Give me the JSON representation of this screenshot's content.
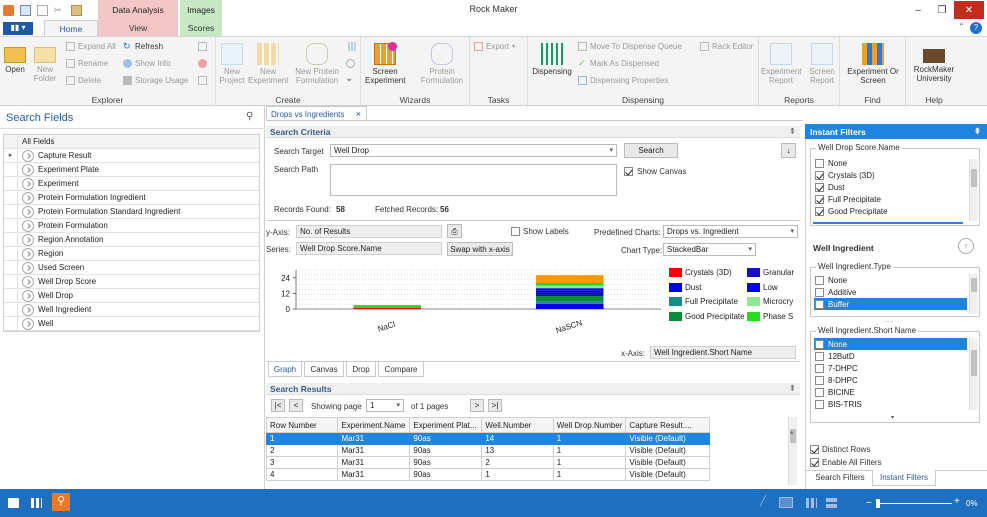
{
  "app": {
    "title": "Rock Maker"
  },
  "context_tabs": {
    "data_analysis": "Data Analysis",
    "images": "Images"
  },
  "tabs": {
    "file": "",
    "home": "Home",
    "view": "View",
    "scores": "Scores"
  },
  "ribbon": {
    "explorer": {
      "label": "Explorer",
      "open": "Open",
      "new_folder": "New\nFolder",
      "expand_all": "Expand All",
      "refresh": "Refresh",
      "rename": "Rename",
      "show_info": "Show Info",
      "delete": "Delete",
      "storage_usage": "Storage Usage"
    },
    "create": {
      "label": "Create",
      "new_project": "New\nProject",
      "new_experiment": "New\nExperiment",
      "new_protein_formulation": "New Protein\nFormulation"
    },
    "wizards": {
      "label": "Wizards",
      "screen_experiment": "Screen\nExperiment",
      "protein_formulation": "Protein\nFormulation"
    },
    "tasks": {
      "label": "Tasks",
      "export": "Export"
    },
    "dispensing": {
      "label": "Dispensing",
      "dispensing": "Dispensing",
      "move_to_queue": "Move To Dispense Queue",
      "rack_editor": "Rack Editor",
      "mark_as_dispensed": "Mark As Dispensed",
      "dispensing_properties": "Dispensing Properties"
    },
    "reports": {
      "label": "Reports",
      "experiment_report": "Experiment\nReport",
      "screen_report": "Screen\nReport"
    },
    "find": {
      "label": "Find",
      "experiment_or_screen": "Experiment Or\nScreen"
    },
    "help": {
      "label": "Help",
      "university": "RockMaker\nUniversity"
    }
  },
  "search_fields": {
    "title": "Search Fields",
    "header": "All Fields",
    "items": [
      "Capture Result",
      "Experiment Plate",
      "Experiment",
      "Protein Formulation Ingredient",
      "Protein Formulation Standard Ingredient",
      "Protein Formulation",
      "Region Annotation",
      "Region",
      "Used Screen",
      "Well Drop Score",
      "Well Drop",
      "Well Ingredient",
      "Well"
    ]
  },
  "doc_tab": {
    "label": "Drops vs Ingredients",
    "close": "×"
  },
  "search_criteria": {
    "title": "Search Criteria",
    "target_label": "Search Target",
    "target_value": "Well Drop",
    "search_button": "Search",
    "path_label": "Search Path",
    "show_canvas": "Show Canvas",
    "records_found_label": "Records Found:",
    "records_found": "58",
    "fetched_label": "Fetched Records:",
    "fetched": "56"
  },
  "chart_controls": {
    "yaxis_label": "y-Axis:",
    "yaxis_value": "No. of Results",
    "series_label": "Series:",
    "series_value": "Well Drop Score.Name",
    "swap_button": "Swap with x-axis",
    "show_labels": "Show Labels",
    "predef_label": "Predefined Charts:",
    "predef_value": "Drops vs. Ingredient",
    "chart_type_label": "Chart Type:",
    "chart_type_value": "StackedBar",
    "xaxis_label": "x-Axis:",
    "xaxis_value": "Well Ingredient.Short Name"
  },
  "chart_data": {
    "type": "bar",
    "stacked": true,
    "categories": [
      "NaCl",
      "NaSCN"
    ],
    "yticks": [
      0,
      12,
      24
    ],
    "ylim": [
      0,
      30
    ],
    "grid": true,
    "legend_position": "right",
    "series": [
      {
        "name": "Crystals (3D)",
        "color": "#ff0000",
        "values": [
          1,
          0
        ]
      },
      {
        "name": "Dust",
        "color": "#0000ee",
        "values": [
          0,
          4
        ]
      },
      {
        "name": "Full Precipitate",
        "color": "#1a8a8a",
        "values": [
          0,
          2
        ]
      },
      {
        "name": "Good Precipitate",
        "color": "#0f8a3a",
        "values": [
          0,
          4
        ]
      },
      {
        "name": "Granular",
        "color": "#1414b4",
        "values": [
          0,
          4
        ]
      },
      {
        "name": "Low",
        "color": "#0000ff",
        "values": [
          0,
          2
        ]
      },
      {
        "name": "Microcrystals",
        "color": "#90e890",
        "values": [
          0,
          2
        ]
      },
      {
        "name": "Phase Separation",
        "color": "#22dd22",
        "values": [
          2,
          2
        ]
      },
      {
        "name": "",
        "color": "#ff9900",
        "values": [
          0,
          6
        ]
      }
    ],
    "legend_labels": [
      "Crystals (3D)",
      "Dust",
      "Full Precipitate",
      "Good Precipitate",
      "Granular",
      "Low",
      "Microcry",
      "Phase S"
    ]
  },
  "bottom_tabs": [
    "Graph",
    "Canvas",
    "Drop",
    "Compare"
  ],
  "results": {
    "title": "Search Results",
    "showing": "Showing page",
    "page": "1",
    "of_pages": "of 1 pages",
    "columns": [
      "Row Number",
      "Experiment.Name",
      "Experiment Plat...",
      "Well.Number",
      "Well Drop.Number",
      "Capture Result...."
    ],
    "rows": [
      [
        "1",
        "Mar31",
        "90as",
        "14",
        "1",
        "Visible (Default)"
      ],
      [
        "2",
        "Mar31",
        "90as",
        "13",
        "1",
        "Visible (Default)"
      ],
      [
        "3",
        "Mar31",
        "90as",
        "2",
        "1",
        "Visible (Default)"
      ],
      [
        "4",
        "Mar31",
        "90as",
        "1",
        "1",
        "Visible (Default)"
      ]
    ]
  },
  "instant_filters": {
    "title": "Instant Filters",
    "score_group": {
      "legend": "Well Drop Score.Name",
      "items": [
        {
          "label": "None",
          "checked": false
        },
        {
          "label": "Crystals (3D)",
          "checked": true
        },
        {
          "label": "Dust",
          "checked": true
        },
        {
          "label": "Full Precipitate",
          "checked": true
        },
        {
          "label": "Good Precipitate",
          "checked": true
        }
      ]
    },
    "ingredient_header": "Well Ingredient",
    "type_group": {
      "legend": "Well Ingredient.Type",
      "items": [
        {
          "label": "None",
          "checked": false
        },
        {
          "label": "Additive",
          "checked": false
        },
        {
          "label": "Buffer",
          "checked": false
        }
      ]
    },
    "short_group": {
      "legend": "Well Ingredient.Short Name",
      "items": [
        {
          "label": "None",
          "checked": false
        },
        {
          "label": "12ButD",
          "checked": false
        },
        {
          "label": "7-DHPC",
          "checked": false
        },
        {
          "label": "8-DHPC",
          "checked": false
        },
        {
          "label": "BICINE",
          "checked": false
        },
        {
          "label": "BIS-TRIS",
          "checked": false
        }
      ]
    },
    "distinct_rows": "Distinct Rows",
    "enable_all": "Enable All Filters",
    "tabs": [
      "Search Filters",
      "Instant Filters"
    ]
  },
  "status": {
    "zoom": "0%"
  }
}
